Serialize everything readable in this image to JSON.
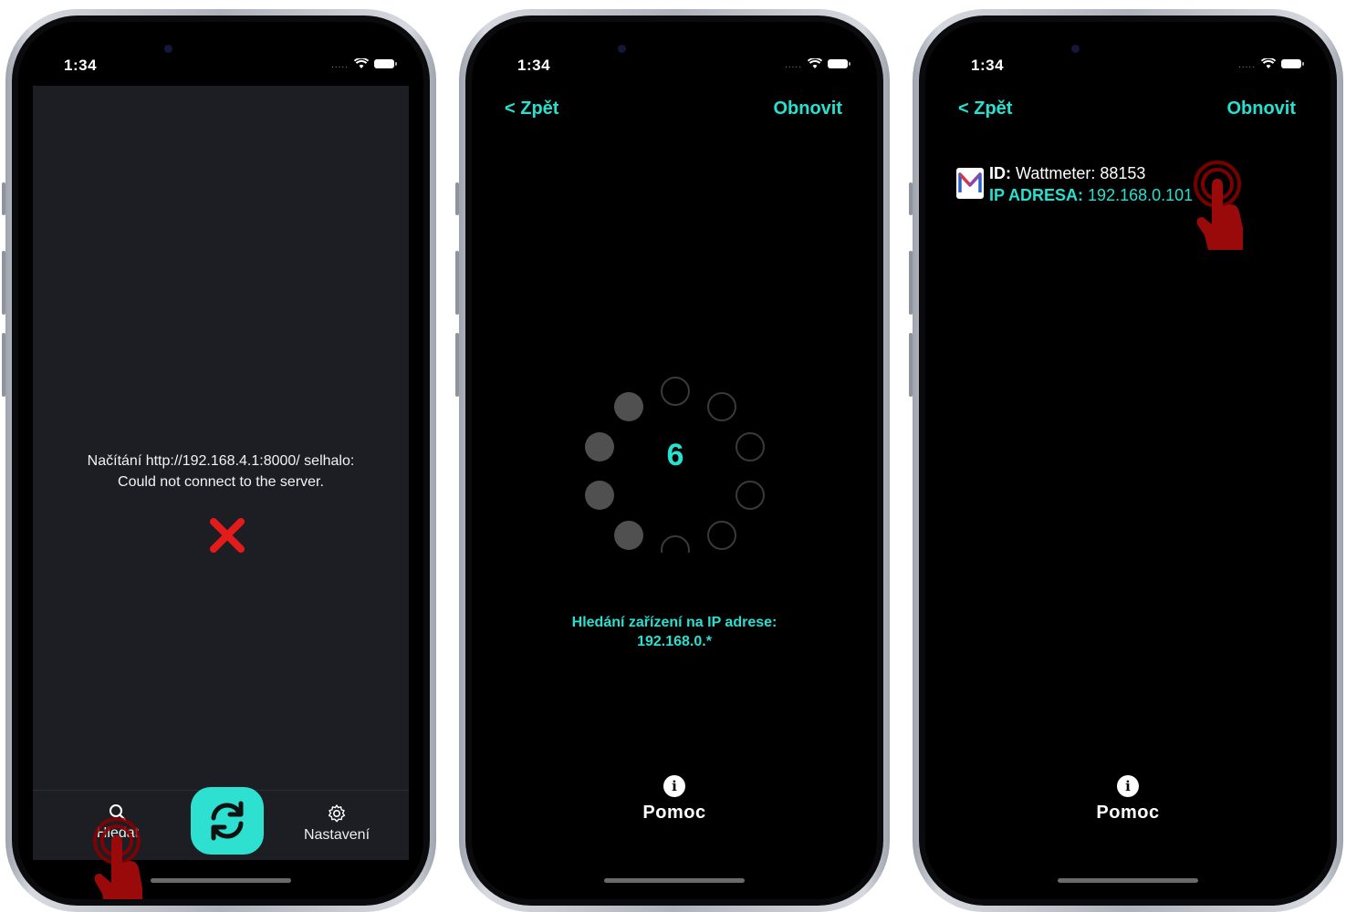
{
  "status": {
    "time": "1:34",
    "signal_dots": "....."
  },
  "screen1": {
    "error_line1": "Načítání http://192.168.4.1:8000/ selhalo:",
    "error_line2": "Could not connect to the server.",
    "tabs": {
      "search": "Hledat",
      "settings": "Nastavení"
    }
  },
  "screen2": {
    "back": "< Zpět",
    "refresh": "Obnovit",
    "counter": "6",
    "scan_line1": "Hledání zařízení na IP adrese:",
    "scan_line2": "192.168.0.*",
    "help": "Pomoc"
  },
  "screen3": {
    "back": "< Zpět",
    "refresh": "Obnovit",
    "device": {
      "id_label": "ID:",
      "id_value": "Wattmeter: 88153",
      "ip_label": "IP ADRESA:",
      "ip_value": "192.168.0.101"
    },
    "help": "Pomoc"
  },
  "colors": {
    "accent": "#27e0cf",
    "error": "#e41b1b",
    "panel": "#1c1e24",
    "touch": "#8b0000"
  }
}
